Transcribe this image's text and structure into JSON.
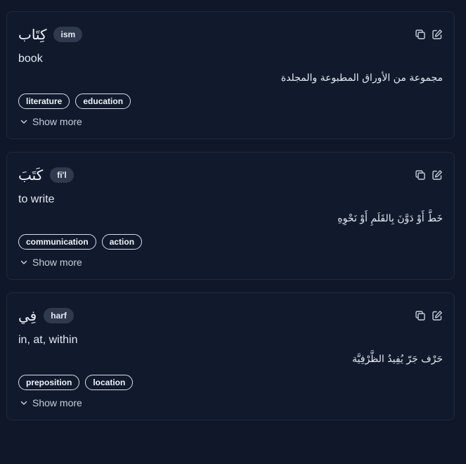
{
  "entries": [
    {
      "word": "كِتَاب",
      "pos": "ism",
      "meaning": "book",
      "definition": "مجموعة من الأوراق المطبوعة والمجلدة",
      "tags": [
        "literature",
        "education"
      ],
      "show_more": "Show more"
    },
    {
      "word": "كَتَبَ",
      "pos": "fi'l",
      "meaning": "to write",
      "definition": "خَطَّ أَوْ دَوَّنَ بِالقَلَمِ أَوْ نَحْوِهِ",
      "tags": [
        "communication",
        "action"
      ],
      "show_more": "Show more"
    },
    {
      "word": "فِي",
      "pos": "harf",
      "meaning": "in, at, within",
      "definition": "حَرْف جَرّ يُفِيدُ الظَّرْفِيَّة",
      "tags": [
        "preposition",
        "location"
      ],
      "show_more": "Show more"
    }
  ],
  "icons": {
    "copy": "copy-icon",
    "edit": "edit-icon",
    "chevron": "chevron-down-icon"
  },
  "colors": {
    "background": "#0f1729",
    "card": "#111a2d",
    "badge": "#2f3a4e"
  }
}
